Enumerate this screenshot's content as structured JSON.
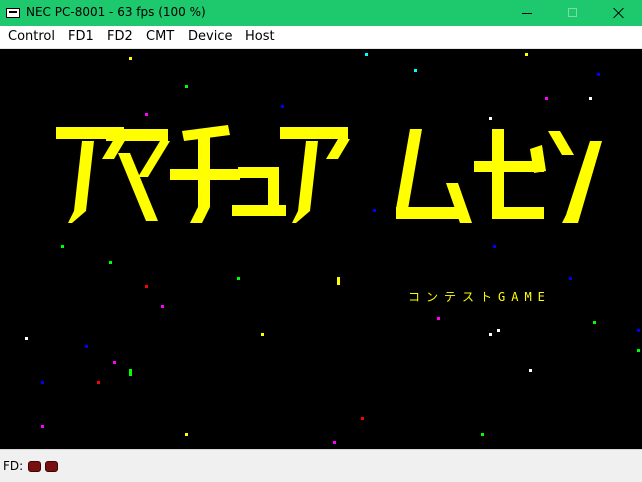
{
  "window": {
    "title": "NEC PC-8001 - 63 fps (100 %)",
    "titlebar_color": "#1ec86c"
  },
  "menu": {
    "control": "Control",
    "fd1": "FD1",
    "fd2": "FD2",
    "cmt": "CMT",
    "device": "Device",
    "host": "Host"
  },
  "screen": {
    "background": "#000000",
    "logo_text": "アマチュアムセン",
    "logo_color": "#ffff00",
    "subtitle": "コンテストGAME"
  },
  "status": {
    "label": "FD:",
    "drive_led_color": "#7a0f0f"
  }
}
